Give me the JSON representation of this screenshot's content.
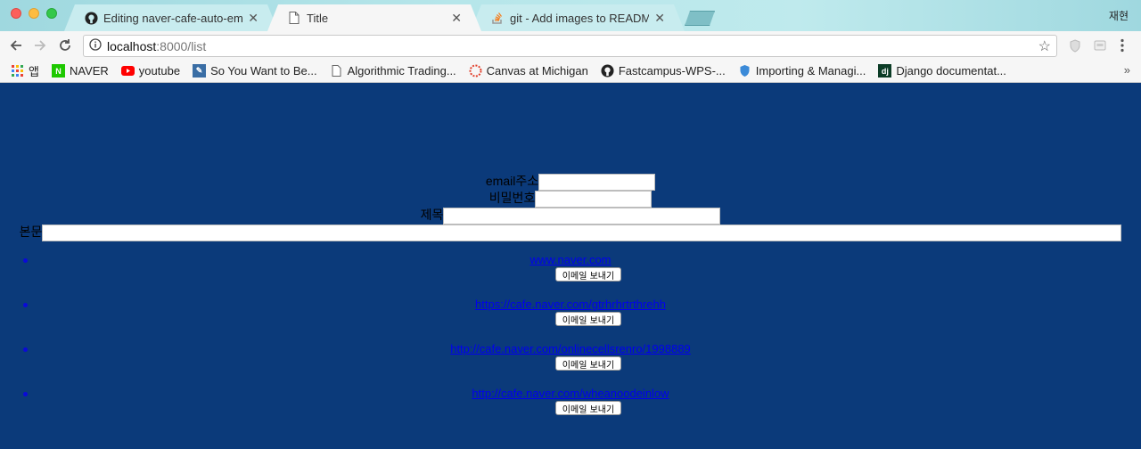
{
  "window": {
    "profile_name": "재현"
  },
  "tabs": [
    {
      "title": "Editing naver-cafe-auto-email",
      "icon": "github-icon",
      "active": false
    },
    {
      "title": "Title",
      "icon": "document-icon",
      "active": true
    },
    {
      "title": "git - Add images to README.m",
      "icon": "stackoverflow-icon",
      "active": false
    }
  ],
  "address_bar": {
    "host": "localhost",
    "path": ":8000/list"
  },
  "bookmarks": [
    {
      "label": "앱",
      "icon": "apps-grid-icon"
    },
    {
      "label": "NAVER",
      "icon": "naver-icon"
    },
    {
      "label": "youtube",
      "icon": "youtube-icon"
    },
    {
      "label": "So You Want to Be...",
      "icon": "site-icon"
    },
    {
      "label": "Algorithmic Trading...",
      "icon": "document-icon"
    },
    {
      "label": "Canvas at Michigan",
      "icon": "canvas-icon"
    },
    {
      "label": "Fastcampus-WPS-...",
      "icon": "github-icon"
    },
    {
      "label": "Importing & Managi...",
      "icon": "shield-icon"
    },
    {
      "label": "Django documentat...",
      "icon": "django-icon"
    }
  ],
  "form": {
    "email_label": "email주소",
    "password_label": "비밀번호",
    "subject_label": "제목",
    "body_label": "본문"
  },
  "links": [
    {
      "url": "www.naver.com",
      "button_label": "이메일 보내기"
    },
    {
      "url": "https://cafe.naver.com/gtrhrhrtrthrehh",
      "button_label": "이메일 보내기"
    },
    {
      "url": "http://cafe.naver.com/onlinecellsrenro/1998889",
      "button_label": "이메일 보내기"
    },
    {
      "url": "http://cafe.naver.com/wheanoodeinlow",
      "button_label": "이메일 보내기"
    }
  ]
}
